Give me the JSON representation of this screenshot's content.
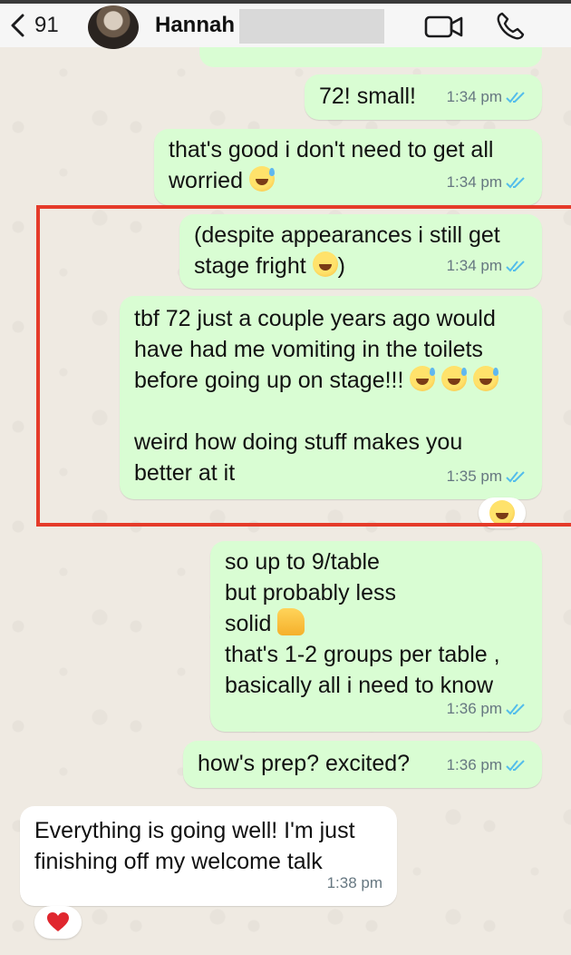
{
  "header": {
    "back_count": "91",
    "contact_name": "Hannah"
  },
  "messages": [
    {
      "id": "m1",
      "direction": "out",
      "text": "72! small!",
      "time": "1:34 pm",
      "status": "read"
    },
    {
      "id": "m2",
      "direction": "out",
      "text": "that's good i don't need to get all\nworried",
      "trailing_emoji": "grinning-sweat",
      "time": "1:34 pm",
      "status": "read"
    },
    {
      "id": "m3",
      "direction": "out",
      "text": "(despite appearances i still get\nstage fright",
      "inline_emoji": "tears-of-joy",
      "text_after_emoji": ")",
      "time": "1:34 pm",
      "status": "read"
    },
    {
      "id": "m4",
      "direction": "out",
      "text": "tbf 72 just a couple years ago would\nhave had me vomiting in the toilets\nbefore going up on stage!!!",
      "trailing_emojis": [
        "grinning-sweat",
        "grinning-sweat",
        "grinning-sweat"
      ],
      "text2": "weird how doing stuff makes you\nbetter at it",
      "time": "1:35 pm",
      "status": "read",
      "reaction": "tears-of-joy"
    },
    {
      "id": "m5",
      "direction": "out",
      "text": "so up to 9/table\nbut probably less\nsolid",
      "inline_emoji": "thumbs-up",
      "text2": "that's 1-2 groups per table ,\nbasically all i need to know",
      "time": "1:36 pm",
      "status": "read"
    },
    {
      "id": "m6",
      "direction": "out",
      "text": "how's prep? excited?",
      "time": "1:36 pm",
      "status": "read"
    },
    {
      "id": "m7",
      "direction": "in",
      "text": "Everything is going well! I'm just\nfinishing off my welcome talk",
      "time": "1:38 pm",
      "reaction": "red-heart"
    }
  ],
  "colors": {
    "outgoing_bubble": "#d9fdd3",
    "incoming_bubble": "#ffffff",
    "read_ticks": "#53bdeb",
    "highlight_box": "#e53b2a"
  }
}
